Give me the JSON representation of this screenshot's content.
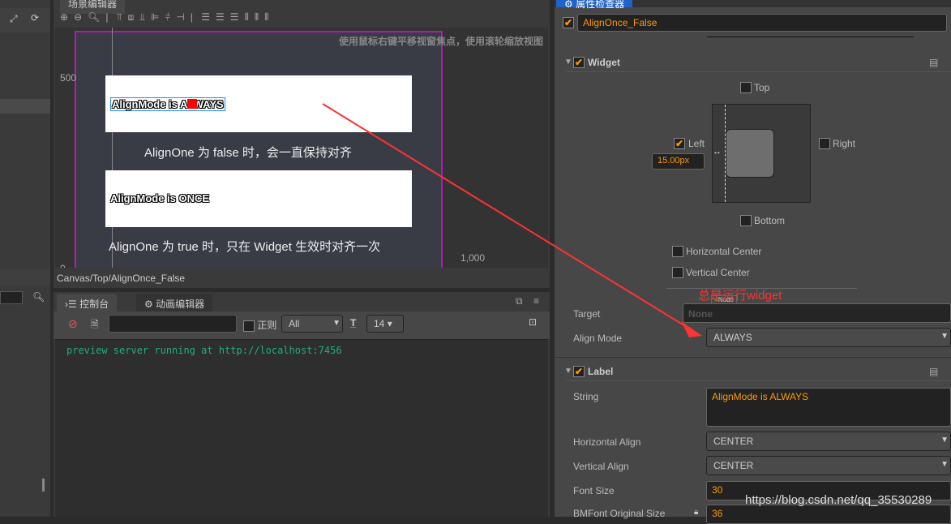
{
  "left_panel": {
    "icons": [
      "expand-icon",
      "refresh-icon",
      "search-icon"
    ]
  },
  "scene": {
    "tab": "场景编辑器",
    "hint": "使用鼠标右键平移视窗焦点，使用滚轮缩放视图",
    "ruler_y_500": "500",
    "ruler_y_0": "0",
    "ruler_x_1000": "1,000",
    "label_always": "AlignMode is ALWAYS",
    "label_once": "AlignMode is ONCE",
    "caption_false": "AlignOne 为 false 时，会一直保持对齐",
    "caption_true": "AlignOne 为 true 时，只在 Widget 生效时对齐一次",
    "breadcrumb": "Canvas/Top/AlignOnce_False"
  },
  "console": {
    "tab_console": "控制台",
    "tab_anim": "动画编辑器",
    "regex_label": "正则",
    "filter": "All",
    "font_size": "14",
    "log": "preview server running at http://localhost:7456"
  },
  "inspector": {
    "tab": "属性检查器",
    "node_name": "AlignOnce_False",
    "widget": {
      "title": "Widget",
      "top": "Top",
      "left": "Left",
      "right": "Right",
      "bottom": "Bottom",
      "left_value": "15.00px",
      "hcenter": "Horizontal Center",
      "vcenter": "Vertical Center",
      "target_label": "Target",
      "target_badge": "Node",
      "target_value": "None",
      "align_mode_label": "Align Mode",
      "align_mode": "ALWAYS"
    },
    "label": {
      "title": "Label",
      "string_label": "String",
      "string": "AlignMode is ALWAYS",
      "halign_label": "Horizontal Align",
      "halign": "CENTER",
      "valign_label": "Vertical Align",
      "valign": "CENTER",
      "font_size_label": "Font Size",
      "font_size": "30",
      "bmfont_label": "BMFont Original Size",
      "bmfont": "36"
    }
  },
  "annotation": {
    "text": "总是运行widget",
    "color": "#ff3333"
  },
  "watermark": "https://blog.csdn.net/qq_35530289",
  "colors": {
    "accent": "#ff9900",
    "selected_tab": "#1f63c7"
  }
}
